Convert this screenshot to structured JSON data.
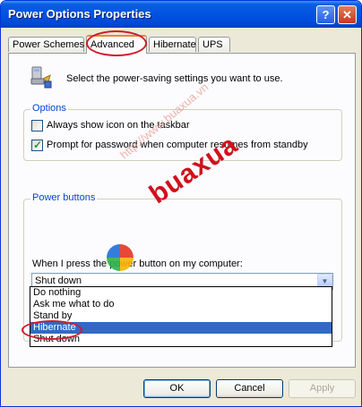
{
  "window": {
    "title": "Power Options Properties",
    "help_glyph": "?",
    "close_glyph": "✕"
  },
  "tabs": [
    {
      "label": "Power Schemes",
      "active": false
    },
    {
      "label": "Advanced",
      "active": true
    },
    {
      "label": "Hibernate",
      "active": false
    },
    {
      "label": "UPS",
      "active": false
    }
  ],
  "header": {
    "icon": "power-options-icon",
    "text": "Select the power-saving settings you want to use."
  },
  "options": {
    "title": "Options",
    "items": [
      {
        "label": "Always show icon on the taskbar",
        "checked": false
      },
      {
        "label": "Prompt for password when computer resumes from standby",
        "checked": true
      }
    ]
  },
  "power_buttons": {
    "title": "Power buttons",
    "when_label": "When I press the power button on my computer:",
    "selected_value": "Shut down",
    "dropdown_options": [
      "Do nothing",
      "Ask me what to do",
      "Stand by",
      "Hibernate",
      "Shut down"
    ],
    "highlighted_option": "Hibernate"
  },
  "buttons": {
    "ok": "OK",
    "cancel": "Cancel",
    "apply": "Apply"
  },
  "watermark": {
    "url": "http://www.buaxua.vn",
    "logo": "buaxua"
  },
  "colors": {
    "titlebar": "#0054e3",
    "group_title": "#0046d5",
    "selection": "#316ac5",
    "annotation_ring": "#d0192b",
    "check": "#21a121"
  }
}
